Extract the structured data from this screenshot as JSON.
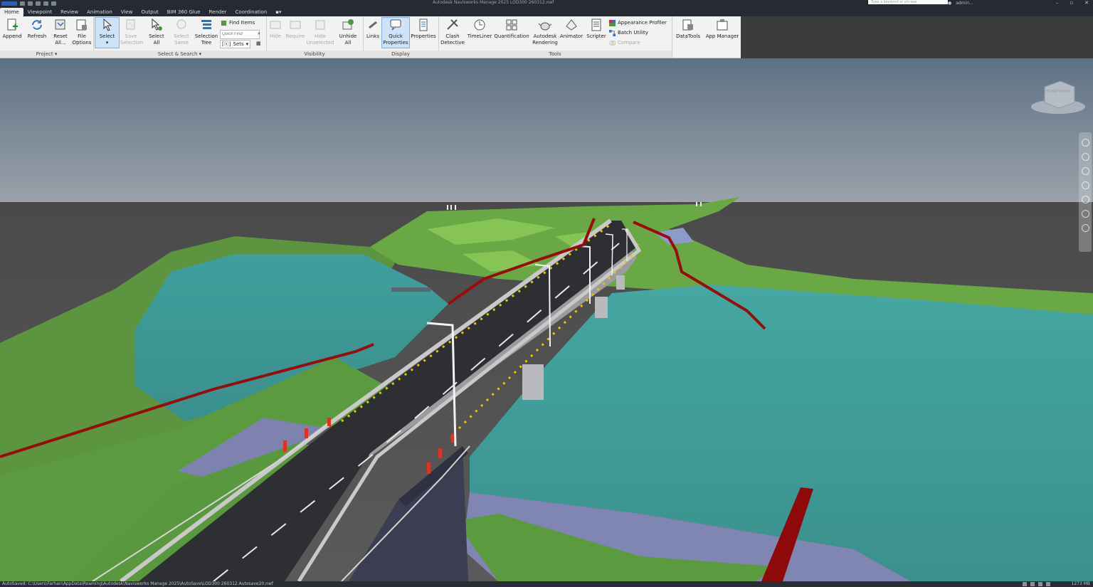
{
  "app": {
    "title": "Autodesk Navisworks Manage 2025   LOD300 260312.nwf",
    "search_placeholder": "Type a keyword or phrase",
    "user": "admin..."
  },
  "tabs": [
    {
      "label": "Home",
      "active": true
    },
    {
      "label": "Viewpoint"
    },
    {
      "label": "Review"
    },
    {
      "label": "Animation"
    },
    {
      "label": "View"
    },
    {
      "label": "Output"
    },
    {
      "label": "BIM 360 Glue"
    },
    {
      "label": "Render"
    },
    {
      "label": "Coordination"
    }
  ],
  "ribbon": {
    "project": {
      "label": "Project ▾",
      "append": "Append",
      "refresh": "Refresh",
      "reset_all_1": "Reset",
      "reset_all_2": "All...",
      "file_options_1": "File",
      "file_options_2": "Options"
    },
    "select_search": {
      "label": "Select & Search ▾",
      "select": "Select",
      "save_selection_1": "Save",
      "save_selection_2": "Selection",
      "select_all_1": "Select",
      "select_all_2": "All",
      "select_same_1": "Select",
      "select_same_2": "Same",
      "selection_tree_1": "Selection",
      "selection_tree_2": "Tree",
      "find_items": "Find Items",
      "quick_find_placeholder": "Quick Find",
      "sets": "Sets"
    },
    "visibility": {
      "label": "Visibility",
      "hide": "Hide",
      "require": "Require",
      "hide_unselected_1": "Hide",
      "hide_unselected_2": "Unselected",
      "unhide_all_1": "Unhide",
      "unhide_all_2": "All"
    },
    "display": {
      "label": "Display",
      "links": "Links",
      "quick_properties_1": "Quick",
      "quick_properties_2": "Properties",
      "properties": "Properties"
    },
    "tools": {
      "label": "Tools",
      "clash_detective_1": "Clash",
      "clash_detective_2": "Detective",
      "timeliner": "TimeLiner",
      "quantification": "Quantification",
      "autodesk_rendering_1": "Autodesk",
      "autodesk_rendering_2": "Rendering",
      "animator": "Animator",
      "scripter": "Scripter",
      "appearance_profiler": "Appearance Profiler",
      "batch_utility": "Batch Utility",
      "compare": "Compare"
    },
    "extra": {
      "datatools": "DataTools",
      "app_manager": "App Manager"
    }
  },
  "viewcube": {
    "face_label": "FRONT RIGHT"
  },
  "status": {
    "path": "AutoSaved: C:\\Users\\Farhan\\AppData\\Roaming\\Autodesk\\Navisworks Manage 2025\\AutoSave\\LOD300 260312.Autosave20.nwf",
    "memory": "1273 MB"
  },
  "colors": {
    "accent": "#2d5fb8",
    "water": "#3f9f9c",
    "terrain": "#5f9c3e",
    "road": "#2e2f33",
    "boundary": "#9a0c0c"
  }
}
